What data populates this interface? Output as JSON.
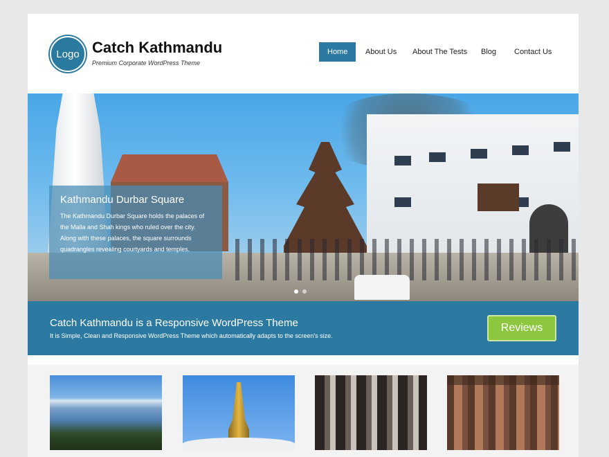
{
  "header": {
    "logo_text": "Logo",
    "site_title": "Catch Kathmandu",
    "tagline": "Premium Corporate WordPress Theme"
  },
  "nav": {
    "items": [
      {
        "label": "Home",
        "active": true
      },
      {
        "label": "About Us",
        "active": false
      },
      {
        "label": "About The Tests",
        "active": false
      },
      {
        "label": "Blog",
        "active": false
      },
      {
        "label": "Contact Us",
        "active": false
      }
    ]
  },
  "slider": {
    "caption_title": "Kathmandu Durbar Square",
    "caption_text": "The Kathmandu Durbar Square holds the palaces of the Malla and Shah kings who ruled over the city. Along with these palaces, the square surrounds quadrangles revealing courtyards and temples.",
    "slide_count": 2,
    "active_slide": 1
  },
  "promo": {
    "title": "Catch Kathmandu is a Responsive WordPress Theme",
    "text": "It is Simple, Clean and Responsive WordPress Theme which automatically adapts to the screen's size.",
    "button_label": "Reviews"
  },
  "colors": {
    "accent": "#2c7aa2",
    "button_green": "#8dc63f",
    "page_bg": "#e8e8e8"
  }
}
